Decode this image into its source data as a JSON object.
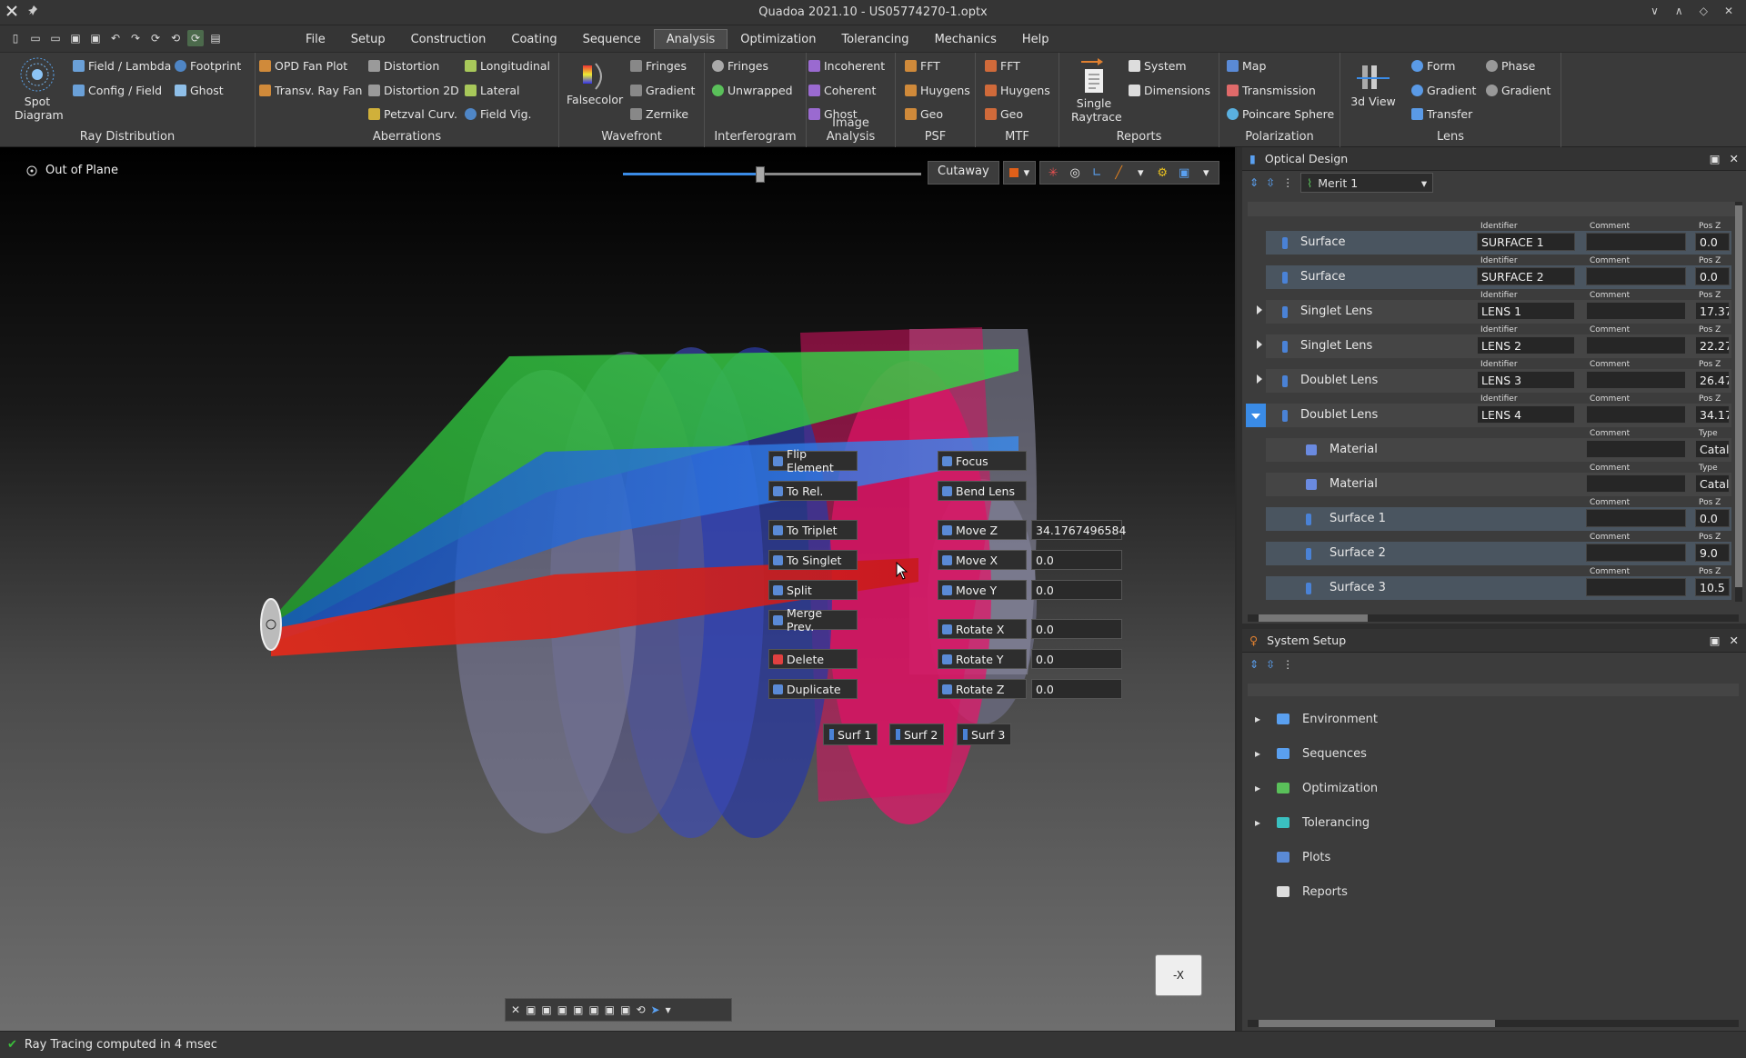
{
  "window": {
    "title": "Quadoa 2021.10 - US05774270-1.optx"
  },
  "menu": [
    "File",
    "Setup",
    "Construction",
    "Coating",
    "Sequence",
    "Analysis",
    "Optimization",
    "Tolerancing",
    "Mechanics",
    "Help"
  ],
  "menu_active": "Analysis",
  "ribbon": {
    "ray_distribution": {
      "label": "Ray Distribution",
      "spot": "Spot Diagram",
      "field_lambda": "Field / Lambda",
      "config_field": "Config / Field",
      "footprint": "Footprint",
      "ghost": "Ghost"
    },
    "aberrations": {
      "label": "Aberrations",
      "opd": "OPD Fan Plot",
      "transv": "Transv. Ray Fan",
      "distortion": "Distortion",
      "distortion2d": "Distortion 2D",
      "petzval": "Petzval Curv.",
      "longitudinal": "Longitudinal",
      "lateral": "Lateral",
      "fieldvig": "Field Vig."
    },
    "wavefront": {
      "label": "Wavefront",
      "falsecolor": "Falsecolor",
      "fringes": "Fringes",
      "gradient": "Gradient",
      "zernike": "Zernike"
    },
    "interferogram": {
      "label": "Interferogram",
      "fringes": "Fringes",
      "unwrapped": "Unwrapped"
    },
    "image_analysis": {
      "label": "Image Analysis",
      "incoherent": "Incoherent",
      "coherent": "Coherent",
      "ghost": "Ghost"
    },
    "psf": {
      "label": "PSF",
      "fft": "FFT",
      "huygens": "Huygens",
      "geo": "Geo"
    },
    "mtf": {
      "label": "MTF",
      "fft": "FFT",
      "huygens": "Huygens",
      "geo": "Geo"
    },
    "reports": {
      "label": "Reports",
      "single": "Single Raytrace",
      "system": "System",
      "dimensions": "Dimensions"
    },
    "polarization": {
      "label": "Polarization",
      "map": "Map",
      "transmission": "Transmission",
      "poincare": "Poincare Sphere"
    },
    "lens": {
      "label": "Lens",
      "view3d": "3d View",
      "form": "Form",
      "gradient": "Gradient",
      "transfer": "Transfer",
      "phase": "Phase",
      "gradient2": "Gradient"
    }
  },
  "viewport": {
    "mode_label": "Out of Plane",
    "cutaway": "Cutaway",
    "cutaway_slider_fraction": 0.46,
    "context_left": [
      "Flip Element",
      "To Rel.",
      "To Triplet",
      "To Singlet",
      "Split",
      "Merge Prev.",
      "Delete",
      "Duplicate"
    ],
    "context_right": [
      "Focus",
      "Bend Lens",
      "Move Z",
      "Move X",
      "Move Y",
      "Rotate X",
      "Rotate Y",
      "Rotate Z"
    ],
    "values": {
      "move_z": "34.1767496584",
      "move_x": "0.0",
      "move_y": "0.0",
      "rot_x": "0.0",
      "rot_y": "0.0",
      "rot_z": "0.0"
    },
    "surf_buttons": [
      "Surf 1",
      "Surf 2",
      "Surf 3"
    ],
    "viewcube": "-X"
  },
  "optical_design": {
    "title": "Optical Design",
    "merit": "Merit 1",
    "headers": {
      "identifier": "Identifier",
      "comment": "Comment",
      "posz": "Pos Z",
      "type": "Type"
    },
    "rows": [
      {
        "label": "Surface",
        "id": "SURFACE 1",
        "pos": "0.0"
      },
      {
        "label": "Surface",
        "id": "SURFACE 2",
        "pos": "0.0"
      },
      {
        "label": "Singlet Lens",
        "id": "LENS 1",
        "pos": "17.37"
      },
      {
        "label": "Singlet Lens",
        "id": "LENS 2",
        "pos": "22.27"
      },
      {
        "label": "Doublet Lens",
        "id": "LENS 3",
        "pos": "26.47"
      },
      {
        "label": "Doublet Lens",
        "id": "LENS 4",
        "pos": "34.17"
      },
      {
        "label": "Material",
        "id": "",
        "pos": "Catal"
      },
      {
        "label": "Material",
        "id": "",
        "pos": "Catal"
      },
      {
        "label": "Surface 1",
        "id": "",
        "pos": "0.0"
      },
      {
        "label": "Surface 2",
        "id": "",
        "pos": "9.0"
      },
      {
        "label": "Surface 3",
        "id": "",
        "pos": "10.5"
      }
    ]
  },
  "system_setup": {
    "title": "System Setup",
    "items": [
      "Environment",
      "Sequences",
      "Optimization",
      "Tolerancing",
      "Plots",
      "Reports"
    ]
  },
  "status": {
    "text": "Ray Tracing computed in 4 msec"
  }
}
